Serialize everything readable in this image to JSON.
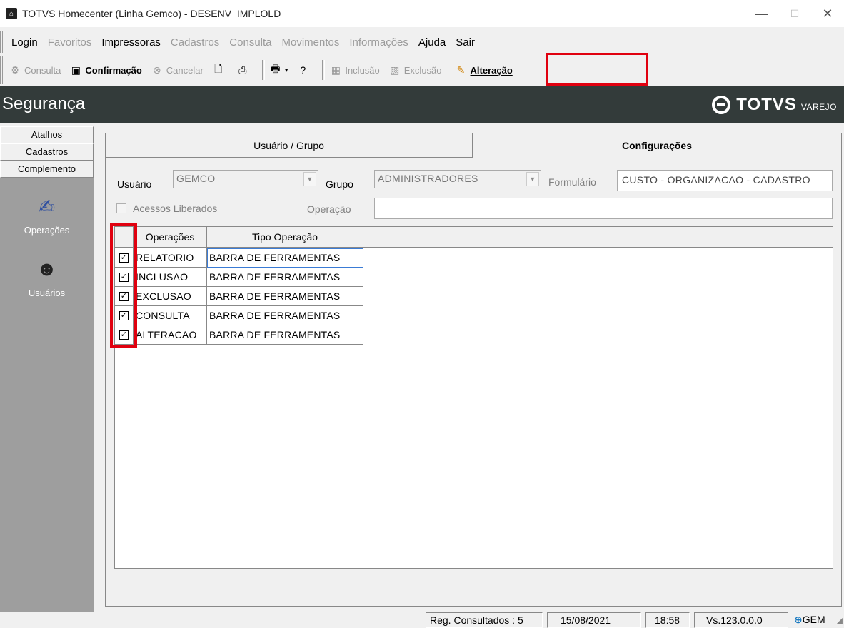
{
  "window": {
    "title": "TOTVS Homecenter (Linha Gemco) - DESENV_IMPLOLD"
  },
  "menu": [
    {
      "label": "Login",
      "enabled": true
    },
    {
      "label": "Favoritos",
      "enabled": false
    },
    {
      "label": "Impressoras",
      "enabled": true
    },
    {
      "label": "Cadastros",
      "enabled": false
    },
    {
      "label": "Consulta",
      "enabled": false
    },
    {
      "label": "Movimentos",
      "enabled": false
    },
    {
      "label": "Informações",
      "enabled": false
    },
    {
      "label": "Ajuda",
      "enabled": true
    },
    {
      "label": "Sair",
      "enabled": true
    }
  ],
  "toolbar": {
    "consulta": "Consulta",
    "confirmacao": "Confirmação",
    "cancelar": "Cancelar",
    "inclusao": "Inclusão",
    "exclusao": "Exclusão",
    "alteracao": "Alteração"
  },
  "banner": {
    "heading": "Segurança",
    "logo_word": "TOTVS",
    "logo_sub": "VAREJO"
  },
  "sidebar": {
    "tabs": [
      "Atalhos",
      "Cadastros",
      "Complemento"
    ],
    "operacoes_label": "Operações",
    "usuarios_label": "Usuários"
  },
  "tabs": {
    "usuario_grupo": "Usuário  / Grupo",
    "configuracoes": "Configurações"
  },
  "form": {
    "usuario_label": "Usuário",
    "usuario_value": "GEMCO",
    "grupo_label": "Grupo",
    "grupo_value": "ADMINISTRADORES",
    "formulario_label": "Formulário",
    "formulario_value": "CUSTO - ORGANIZACAO - CADASTRO",
    "acessos_label": "Acessos Liberados",
    "operacao_label": "Operação",
    "operacao_value": ""
  },
  "grid": {
    "headers": [
      "",
      "Operações",
      "Tipo Operação"
    ],
    "rows": [
      {
        "checked": true,
        "operacao": "RELATORIO",
        "tipo": "BARRA DE FERRAMENTAS"
      },
      {
        "checked": true,
        "operacao": "INCLUSAO",
        "tipo": "BARRA DE FERRAMENTAS"
      },
      {
        "checked": true,
        "operacao": "EXCLUSAO",
        "tipo": "BARRA DE FERRAMENTAS"
      },
      {
        "checked": true,
        "operacao": "CONSULTA",
        "tipo": "BARRA DE FERRAMENTAS"
      },
      {
        "checked": true,
        "operacao": "ALTERACAO",
        "tipo": "BARRA DE FERRAMENTAS"
      }
    ]
  },
  "status": {
    "reg": "Reg. Consultados : 5",
    "date": "15/08/2021",
    "time": "18:58",
    "version": "Vs.123.0.0.0",
    "user": "GEM"
  },
  "colors": {
    "banner_bg": "#333b3a",
    "highlight": "#e0000f",
    "sidebar_bg": "#9e9e9e"
  }
}
